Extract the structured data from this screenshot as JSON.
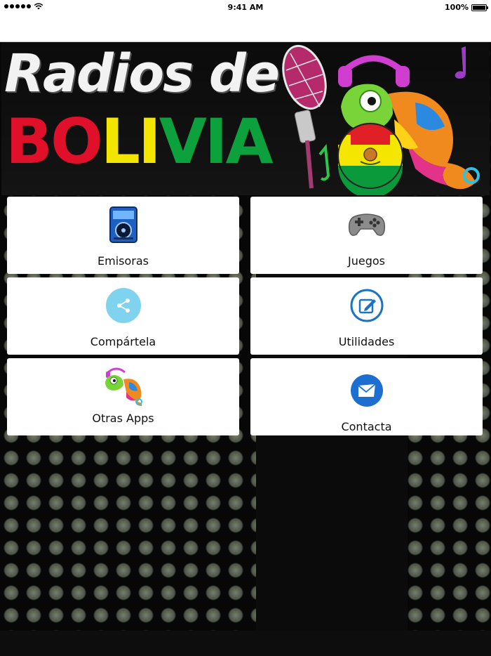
{
  "status_bar": {
    "time": "9:41 AM",
    "battery": "100%",
    "battery_level": 1.0
  },
  "banner": {
    "title_line1": "Radios de",
    "title_line2_parts": [
      "BO",
      "LI",
      "VIA"
    ],
    "title_line2_colors": [
      "#e0102a",
      "#f2e600",
      "#0ca13c"
    ]
  },
  "menu": {
    "items": [
      {
        "label": "Emisoras",
        "icon": "radio-player-icon"
      },
      {
        "label": "Juegos",
        "icon": "gamepad-icon"
      },
      {
        "label": "Compártela",
        "icon": "share-icon"
      },
      {
        "label": "Utilidades",
        "icon": "edit-icon"
      },
      {
        "label": "Otras Apps",
        "icon": "chameleon-icon"
      },
      {
        "label": "Contacta",
        "icon": "mail-icon"
      }
    ]
  },
  "colors": {
    "share_circle": "#7fd3ee",
    "edit_ring": "#1a73c8",
    "mail_circle": "#1c6fd1",
    "tile_background": "#ffffff",
    "page_background": "#070707"
  }
}
